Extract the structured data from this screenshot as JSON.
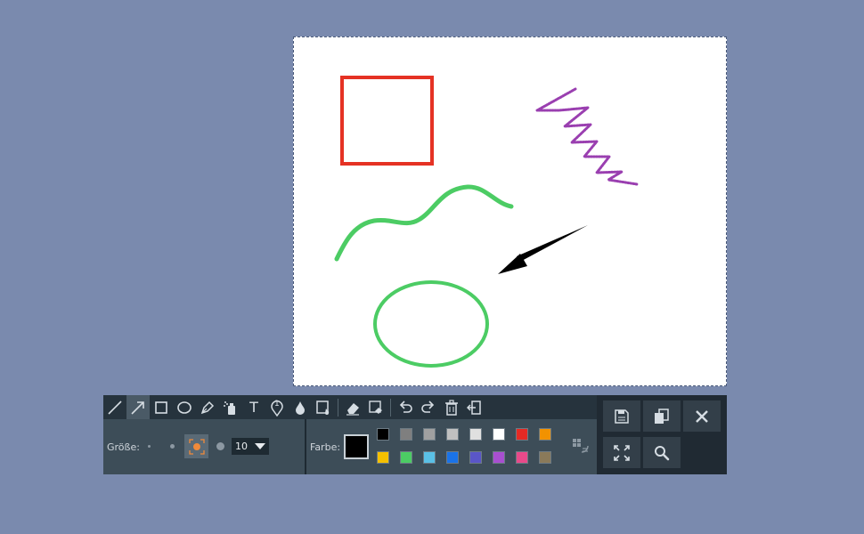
{
  "canvas": {
    "shapes": {
      "rectangle": {
        "color": "#e53224"
      },
      "squiggle": {
        "color": "#4ccc64"
      },
      "ellipse": {
        "color": "#4ccc64"
      },
      "arrow": {
        "color": "#000000"
      },
      "spray": {
        "color": "#9a3fb0"
      }
    }
  },
  "toolbar": {
    "tools": [
      {
        "name": "line-tool",
        "icon": "line-icon"
      },
      {
        "name": "arrow-tool",
        "icon": "arrow-icon",
        "active": true
      },
      {
        "name": "rectangle-tool",
        "icon": "rectangle-icon"
      },
      {
        "name": "ellipse-tool",
        "icon": "ellipse-icon"
      },
      {
        "name": "pen-tool",
        "icon": "pen-icon"
      },
      {
        "name": "spray-tool",
        "icon": "spray-icon"
      },
      {
        "name": "text-tool",
        "icon": "text-icon"
      },
      {
        "name": "numbered-marker-tool",
        "icon": "marker-icon",
        "marker_number": "1"
      },
      {
        "name": "blur-tool",
        "icon": "drop-icon"
      },
      {
        "name": "fill-tool",
        "icon": "fill-icon"
      },
      {
        "name": "eraser-tool",
        "icon": "eraser-icon"
      },
      {
        "name": "erase-area-tool",
        "icon": "erase-area-icon"
      },
      {
        "name": "undo-button",
        "icon": "undo-icon"
      },
      {
        "name": "redo-button",
        "icon": "redo-icon"
      },
      {
        "name": "delete-button",
        "icon": "trash-icon"
      },
      {
        "name": "exit-button",
        "icon": "exit-icon"
      }
    ],
    "text_tool_glyph": "T",
    "size": {
      "label": "Größe:",
      "value": "10"
    },
    "color": {
      "label": "Farbe:",
      "current": "#000000",
      "swatches_row1": [
        "#000000",
        "#7f7f7f",
        "#a0a0a0",
        "#c0c0c0",
        "#e0e0e0",
        "#ffffff",
        "#e52a24",
        "#f29200"
      ],
      "swatches_row2": [
        "#f5c000",
        "#4ccc64",
        "#5ac0e6",
        "#1a73e8",
        "#5a56c8",
        "#a84fd0",
        "#e84a8a",
        "#8a7a5a"
      ]
    },
    "actions": [
      {
        "name": "save-button",
        "icon": "save-icon"
      },
      {
        "name": "copy-button",
        "icon": "copy-icon"
      },
      {
        "name": "close-button",
        "icon": "close-icon"
      },
      {
        "name": "fullscreen-button",
        "icon": "fullscreen-icon"
      },
      {
        "name": "search-button",
        "icon": "search-icon"
      }
    ]
  }
}
